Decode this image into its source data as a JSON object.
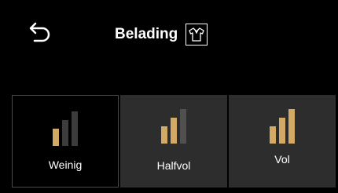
{
  "header": {
    "title": "Belading",
    "back_icon": "back-arrow-icon",
    "shirt_icon": "shirt-icon"
  },
  "options": [
    {
      "label": "Weinig",
      "level": 1,
      "selected": true
    },
    {
      "label": "Halfvol",
      "level": 2,
      "selected": false
    },
    {
      "label": "Vol",
      "level": 3,
      "selected": false
    }
  ],
  "colors": {
    "bar_active": "#d2a965",
    "bar_inactive": "#3c3c3c",
    "bar_inactive_on_grey": "#505050",
    "option_bg": "#2d2d2d",
    "selected_bg": "#000000"
  }
}
